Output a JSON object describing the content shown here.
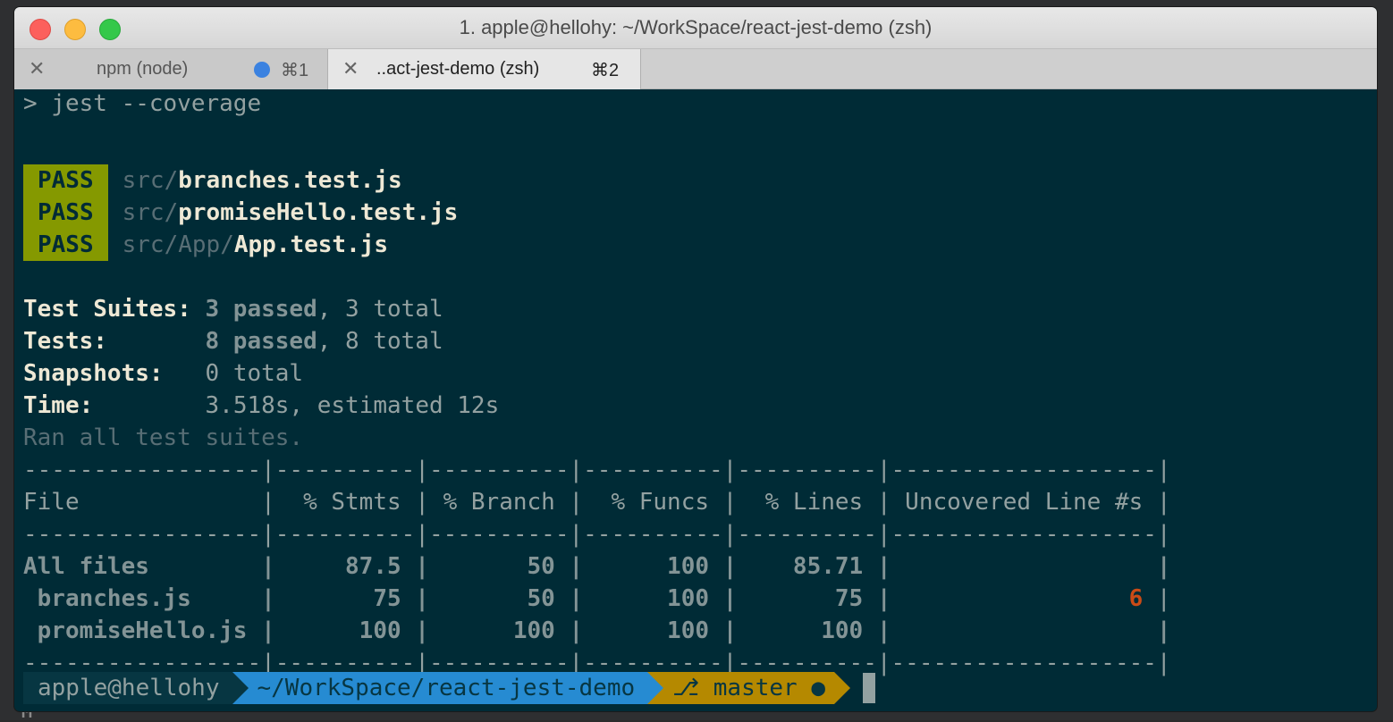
{
  "window": {
    "title": "1. apple@hellohy: ~/WorkSpace/react-jest-demo (zsh)"
  },
  "tabs": [
    {
      "label": "npm (node)",
      "shortcut": "⌘1",
      "close": "✕"
    },
    {
      "label": "..act-jest-demo (zsh)",
      "shortcut": "⌘2",
      "close": "✕"
    }
  ],
  "terminal": {
    "command": "> jest --coverage",
    "pass_badge": "PASS",
    "results": [
      {
        "prefix": "src/",
        "file": "branches.test.js"
      },
      {
        "prefix": "src/",
        "file": "promiseHello.test.js"
      },
      {
        "prefix": "src/App/",
        "file": "App.test.js"
      }
    ],
    "summary": {
      "suites_label": "Test Suites:",
      "suites_passed": "3 passed",
      "suites_total": ", 3 total",
      "tests_label": "Tests:",
      "tests_passed": "8 passed",
      "tests_total": ", 8 total",
      "snapshots_label": "Snapshots:",
      "snapshots_value": "0 total",
      "time_label": "Time:",
      "time_value": "3.518s, estimated 12s",
      "ran": "Ran all test suites."
    },
    "coverage": {
      "separator": "-----------------|----------|----------|----------|----------|-------------------|",
      "header": "File             |  % Stmts | % Branch |  % Funcs |  % Lines | Uncovered Line #s |",
      "rows": [
        {
          "text": "All files        |     87.5 |       50 |      100 |    85.71 |                   |",
          "uncovered": ""
        },
        {
          "text": " branches.js     |       75 |       50 |      100 |       75 |                 ",
          "uncovered": "6"
        },
        {
          "text": " promiseHello.js |      100 |      100 |      100 |      100 |                   |",
          "uncovered": ""
        }
      ],
      "row2_tail": " |"
    },
    "prompt": {
      "user": "apple@hellohy",
      "path": "~/WorkSpace/react-jest-demo",
      "branch_icon": "⎇",
      "branch": "master",
      "dirty": "●"
    }
  }
}
